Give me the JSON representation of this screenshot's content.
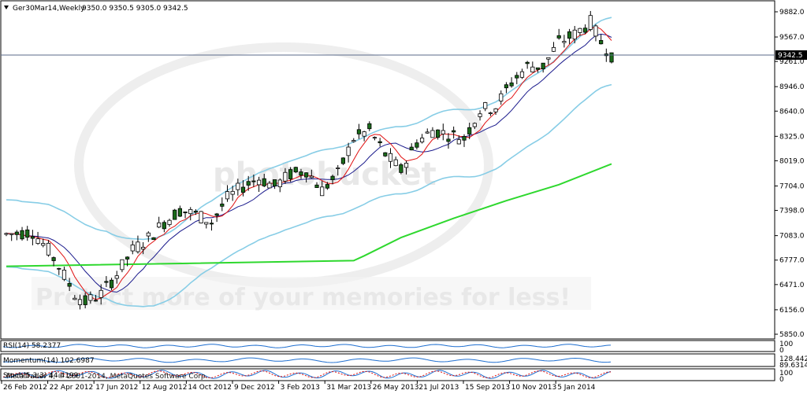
{
  "header": {
    "symbol": "Ger30Mar14,Weekly",
    "ohlc": "9350.0 9350.5 9305.0 9342.5"
  },
  "price_tag": "9342.5",
  "watermark": {
    "logo": "photobucket",
    "tagline": "Protect more of your memories for less!"
  },
  "indicators": {
    "rsi_label": "RSI(14) 58.2377",
    "rsi_levels": [
      "100",
      "0"
    ],
    "momentum_label": "Momentum(14) 102.6987",
    "momentum_levels": [
      "128.4422",
      "89.6314"
    ],
    "stoch_label": "Stoch(5,3,3) 44.4199",
    "stoch_levels": [
      "100",
      "0"
    ],
    "copyright": "MetaTrader 4, © 2001-2014, MetaQuotes Software Corp."
  },
  "colors": {
    "bull": "#ffffff",
    "bear": "#1a6b1a",
    "wick": "#000000",
    "ma_fast": "#e01010",
    "ma_mid": "#1a1a8c",
    "ma_slow": "#2ed82e",
    "bands": "#87cde6",
    "price_line": "#5a6a8a",
    "indicator_line": "#1f6fd0"
  },
  "chart_data": {
    "type": "candlestick",
    "y_ticks": [
      "9882.0",
      "9567.0",
      "9261.0",
      "8946.0",
      "8640.0",
      "8325.0",
      "8019.0",
      "7704.0",
      "7398.0",
      "7083.0",
      "6777.0",
      "6471.0",
      "6156.0",
      "5850.0"
    ],
    "ylim": [
      5850,
      9882
    ],
    "x_ticks": [
      "26 Feb 2012",
      "22 Apr 2012",
      "17 Jun 2012",
      "12 Aug 2012",
      "14 Oct 2012",
      "9 Dec 2012",
      "3 Feb 2013",
      "31 Mar 2013",
      "26 May 2013",
      "21 Jul 2013",
      "15 Sep 2013",
      "10 Nov 2013",
      "5 Jan 2014"
    ],
    "trend_points": [
      {
        "w": 0,
        "v": 7100
      },
      {
        "w": 5,
        "v": 7130
      },
      {
        "w": 8,
        "v": 6900
      },
      {
        "w": 10,
        "v": 6700
      },
      {
        "w": 13,
        "v": 6350
      },
      {
        "w": 15,
        "v": 6250
      },
      {
        "w": 18,
        "v": 6350
      },
      {
        "w": 21,
        "v": 6600
      },
      {
        "w": 24,
        "v": 6900
      },
      {
        "w": 27,
        "v": 7050
      },
      {
        "w": 30,
        "v": 7250
      },
      {
        "w": 33,
        "v": 7400
      },
      {
        "w": 36,
        "v": 7350
      },
      {
        "w": 39,
        "v": 7250
      },
      {
        "w": 42,
        "v": 7550
      },
      {
        "w": 45,
        "v": 7700
      },
      {
        "w": 48,
        "v": 7800
      },
      {
        "w": 51,
        "v": 7700
      },
      {
        "w": 54,
        "v": 7850
      },
      {
        "w": 57,
        "v": 7900
      },
      {
        "w": 60,
        "v": 7650
      },
      {
        "w": 63,
        "v": 7850
      },
      {
        "w": 66,
        "v": 8300
      },
      {
        "w": 69,
        "v": 8400
      },
      {
        "w": 72,
        "v": 8100
      },
      {
        "w": 75,
        "v": 7900
      },
      {
        "w": 78,
        "v": 8250
      },
      {
        "w": 81,
        "v": 8400
      },
      {
        "w": 84,
        "v": 8350
      },
      {
        "w": 87,
        "v": 8300
      },
      {
        "w": 90,
        "v": 8650
      },
      {
        "w": 93,
        "v": 8700
      },
      {
        "w": 96,
        "v": 9000
      },
      {
        "w": 99,
        "v": 9200
      },
      {
        "w": 102,
        "v": 9200
      },
      {
        "w": 105,
        "v": 9500
      },
      {
        "w": 108,
        "v": 9600
      },
      {
        "w": 111,
        "v": 9750
      },
      {
        "w": 113,
        "v": 9500
      },
      {
        "w": 115,
        "v": 9342
      }
    ],
    "series": [
      {
        "name": "ma_slow",
        "values": [
          [
            0,
            6700
          ],
          [
            66,
            6770
          ],
          [
            68,
            6830
          ],
          [
            75,
            7060
          ],
          [
            85,
            7300
          ],
          [
            95,
            7520
          ],
          [
            105,
            7720
          ],
          [
            115,
            7980
          ]
        ]
      }
    ]
  }
}
